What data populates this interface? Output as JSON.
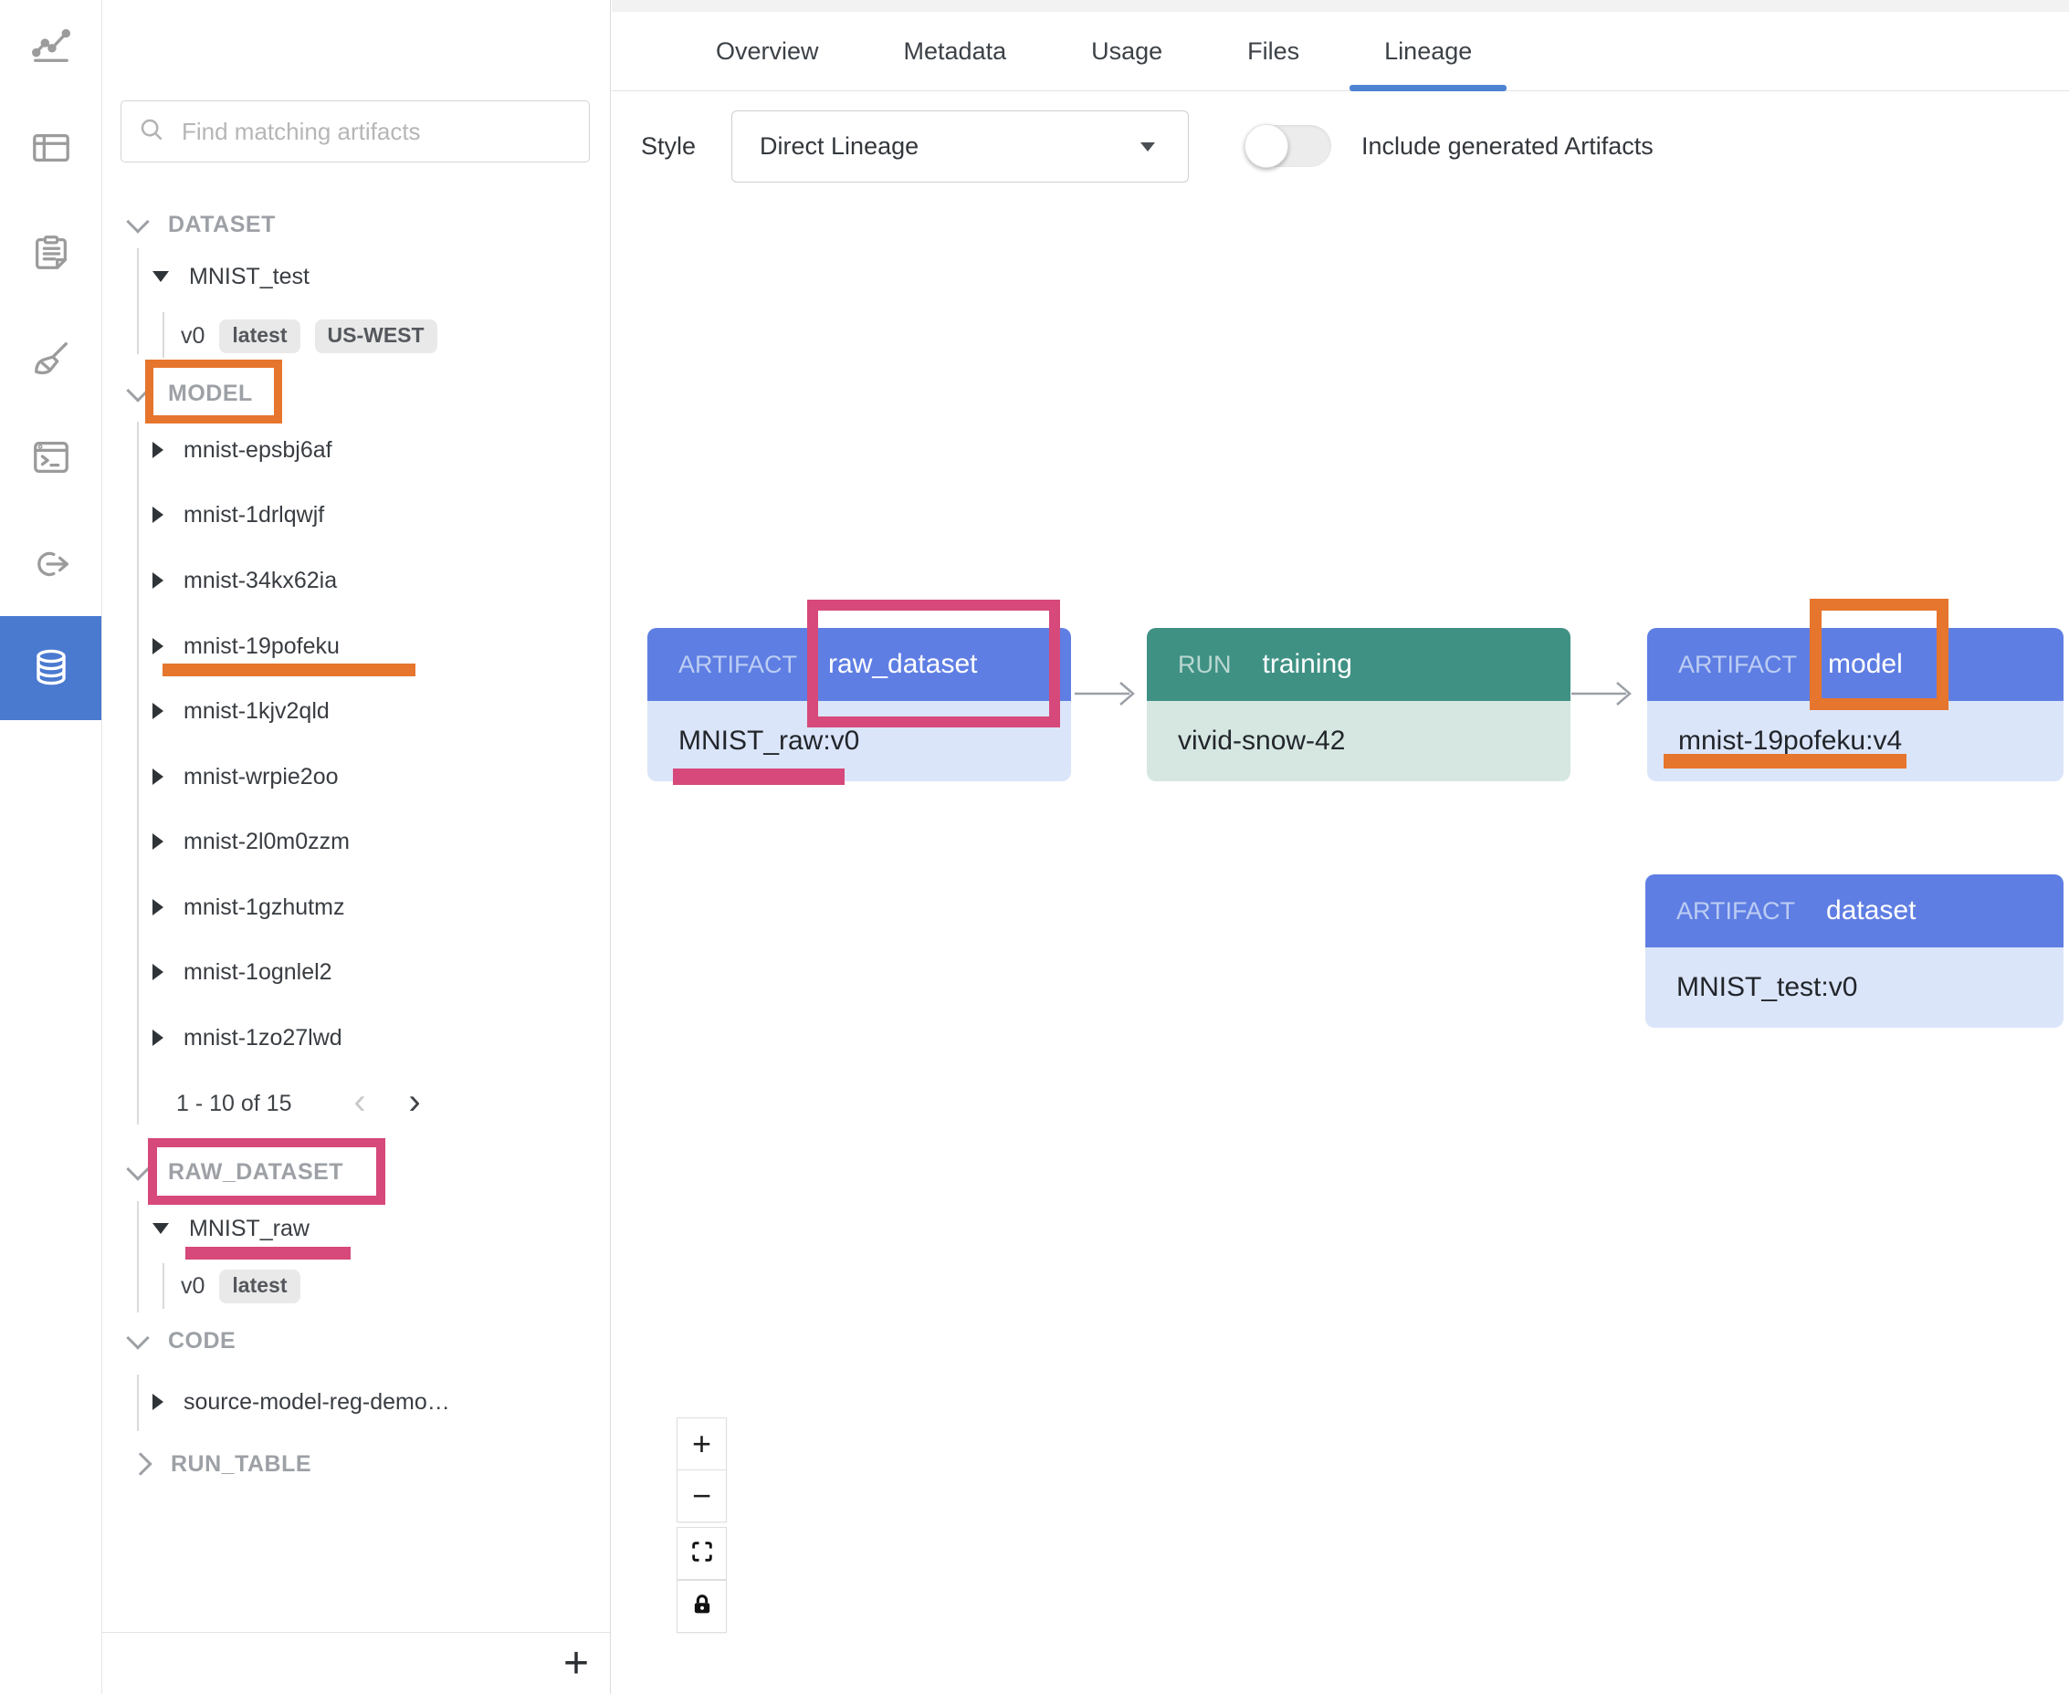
{
  "colors": {
    "accent_blue": "#4e83d3",
    "rail_active_blue": "#4a79d0",
    "artifact_header_blue": "#5f7ee3",
    "artifact_body_blue": "#dbe5f9",
    "run_header_teal": "#3f9184",
    "run_body_teal": "#d6e7e2",
    "annotation_orange": "#e6752d",
    "annotation_pink": "#d6497a"
  },
  "rail": {
    "icons": [
      "line-chart-icon",
      "panels-icon",
      "clipboard-icon",
      "broom-icon",
      "terminal-icon",
      "link-arrow-icon",
      "database-icon"
    ],
    "active": "database-icon"
  },
  "panel": {
    "search_placeholder": "Find matching artifacts",
    "add_button": "+",
    "dataset": {
      "label": "DATASET",
      "entity": "MNIST_test",
      "version": "v0",
      "badges": [
        "latest",
        "US-WEST"
      ]
    },
    "model": {
      "label": "MODEL",
      "items": [
        "mnist-epsbj6af",
        "mnist-1drlqwjf",
        "mnist-34kx62ia",
        "mnist-19pofeku",
        "mnist-1kjv2qld",
        "mnist-wrpie2oo",
        "mnist-2l0m0zzm",
        "mnist-1gzhutmz",
        "mnist-1ognlel2",
        "mnist-1zo27lwd"
      ],
      "pagination": "1 - 10 of 15",
      "prev": "‹",
      "next": "›"
    },
    "raw_dataset": {
      "label": "RAW_DATASET",
      "entity": "MNIST_raw",
      "version": "v0",
      "badges": [
        "latest"
      ]
    },
    "code": {
      "label": "CODE",
      "items": [
        "source-model-reg-demo…"
      ]
    },
    "run_table": {
      "label": "RUN_TABLE"
    }
  },
  "tabs": {
    "items": [
      "Overview",
      "Metadata",
      "Usage",
      "Files",
      "Lineage"
    ],
    "active": "Lineage"
  },
  "controls": {
    "style_label": "Style",
    "style_value": "Direct Lineage",
    "include_label": "Include generated Artifacts",
    "include_on": false
  },
  "graph": {
    "nodes": [
      {
        "kind": "ARTIFACT",
        "type": "raw_dataset",
        "name": "MNIST_raw:v0"
      },
      {
        "kind": "RUN",
        "type": "training",
        "name": "vivid-snow-42"
      },
      {
        "kind": "ARTIFACT",
        "type": "model",
        "name": "mnist-19pofeku:v4"
      },
      {
        "kind": "ARTIFACT",
        "type": "dataset",
        "name": "MNIST_test:v0"
      }
    ],
    "zoom": {
      "zoom_in": "+",
      "zoom_out": "−"
    }
  }
}
